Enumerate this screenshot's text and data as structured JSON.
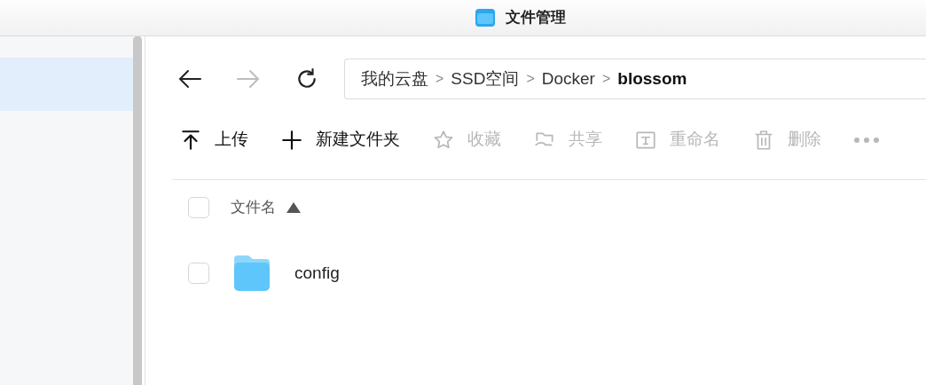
{
  "window": {
    "title": "文件管理"
  },
  "sidebar": {
    "items": [
      {
        "selected": true
      }
    ]
  },
  "nav": {
    "back_disabled": false,
    "forward_disabled": true
  },
  "breadcrumb": [
    {
      "label": "我的云盘",
      "current": false
    },
    {
      "label": "SSD空间",
      "current": false
    },
    {
      "label": "Docker",
      "current": false
    },
    {
      "label": "blossom",
      "current": true
    }
  ],
  "breadcrumb_separator": ">",
  "toolbar": [
    {
      "kind": "upload",
      "label": "上传",
      "disabled": false
    },
    {
      "kind": "new-folder",
      "label": "新建文件夹",
      "disabled": false
    },
    {
      "kind": "favorite",
      "label": "收藏",
      "disabled": true
    },
    {
      "kind": "share",
      "label": "共享",
      "disabled": true
    },
    {
      "kind": "rename",
      "label": "重命名",
      "disabled": true
    },
    {
      "kind": "delete",
      "label": "删除",
      "disabled": true
    },
    {
      "kind": "more",
      "disabled": true
    }
  ],
  "table": {
    "select_all_checked": false,
    "columns": [
      {
        "label": "文件名",
        "sort_ascending": true
      }
    ],
    "rows": [
      {
        "name": "config",
        "kind": "folder",
        "checked": false
      }
    ]
  }
}
